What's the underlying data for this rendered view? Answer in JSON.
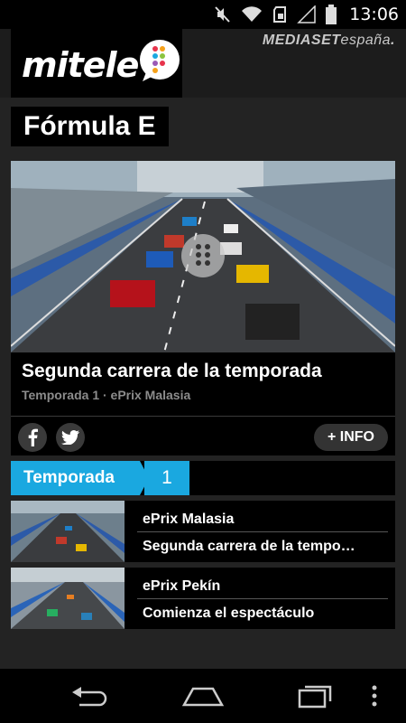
{
  "status_bar": {
    "time": "13:06"
  },
  "header": {
    "logo": "mitele",
    "partner_brand": "MEDIASET",
    "partner_brand_suffix": "españa"
  },
  "section": {
    "title": "Fórmula E"
  },
  "featured": {
    "title": "Segunda carrera de la temporada",
    "subtitle": "Temporada 1 · ePrix Malasia",
    "info_button": "+ INFO",
    "share": [
      "facebook-icon",
      "twitter-icon"
    ]
  },
  "season_selector": {
    "label": "Temporada",
    "value": "1"
  },
  "episodes": [
    {
      "event": "ePrix Malasia",
      "title": "Segunda carrera de la tempo…"
    },
    {
      "event": "ePrix Pekín",
      "title": "Comienza el espectáculo"
    }
  ],
  "colors": {
    "accent": "#1aa8e0",
    "background": "#232323",
    "card": "#000000"
  }
}
